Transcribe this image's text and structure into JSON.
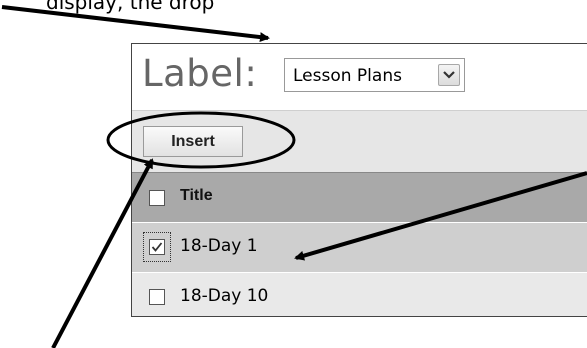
{
  "caption": {
    "top_text": "display, the drop"
  },
  "label_row": {
    "label": "Label:",
    "select_value": "Lesson Plans"
  },
  "toolbar": {
    "insert_label": "Insert"
  },
  "table": {
    "header_title": "Title",
    "rows": [
      {
        "title": "18-Day 1",
        "checked": true
      },
      {
        "title": "18-Day 10",
        "checked": false
      }
    ]
  },
  "colors": {
    "header_bg": "#a9a9a9",
    "selected_row_bg": "#cfcfcf",
    "row_bg": "#e9e9e9",
    "toolbar_bg": "#e6e6e6"
  },
  "icons": [
    "chevron-down-icon",
    "checkmark-icon",
    "annotation-arrow",
    "annotation-ellipse"
  ]
}
